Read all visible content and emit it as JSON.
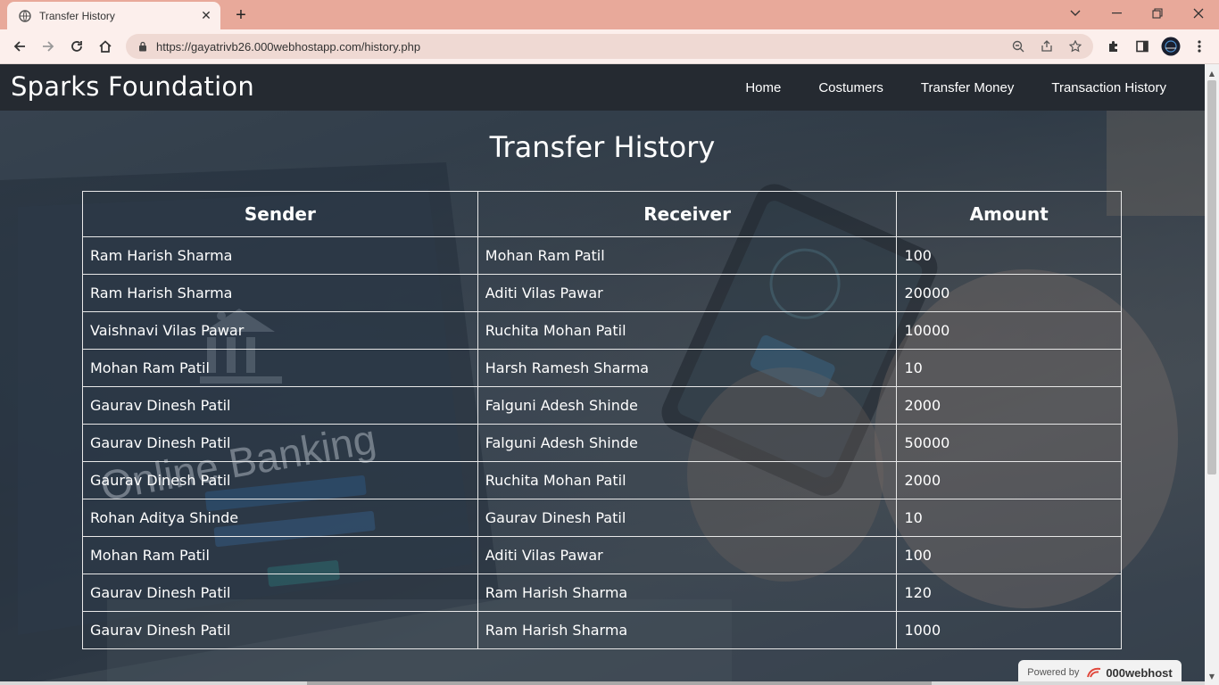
{
  "browser": {
    "tab_title": "Transfer History",
    "tab_close": "✕",
    "new_tab": "+",
    "url": "https://gayatrivb26.000webhostapp.com/history.php",
    "window_controls": {
      "chevron": "⌄",
      "minimize": "—",
      "restore": "❐",
      "close": "✕"
    }
  },
  "navbar": {
    "brand": "Sparks Foundation",
    "links": [
      "Home",
      "Costumers",
      "Transfer Money",
      "Transaction History"
    ]
  },
  "page": {
    "title": "Transfer History"
  },
  "table": {
    "headers": [
      "Sender",
      "Receiver",
      "Amount"
    ],
    "rows": [
      [
        "Ram Harish Sharma",
        "Mohan Ram Patil",
        "100"
      ],
      [
        "Ram Harish Sharma",
        "Aditi Vilas Pawar",
        "20000"
      ],
      [
        "Vaishnavi Vilas Pawar",
        "Ruchita Mohan Patil",
        "10000"
      ],
      [
        "Mohan Ram Patil",
        "Harsh Ramesh Sharma",
        "10"
      ],
      [
        "Gaurav Dinesh Patil",
        "Falguni Adesh Shinde",
        "2000"
      ],
      [
        "Gaurav Dinesh Patil",
        "Falguni Adesh Shinde",
        "50000"
      ],
      [
        "Gaurav Dinesh Patil",
        "Ruchita Mohan Patil",
        "2000"
      ],
      [
        "Rohan Aditya Shinde",
        "Gaurav Dinesh Patil",
        "10"
      ],
      [
        "Mohan Ram Patil",
        "Aditi Vilas Pawar",
        "100"
      ],
      [
        "Gaurav Dinesh Patil",
        "Ram Harish Sharma",
        "120"
      ],
      [
        "Gaurav Dinesh Patil",
        "Ram Harish Sharma",
        "1000"
      ]
    ]
  },
  "background": {
    "watermark_text": "Online Banking"
  },
  "footer_badge": {
    "prefix": "Powered by",
    "brand": "000webhost"
  },
  "colors": {
    "tabbar": "#e8a99a",
    "navbar": "#252a31",
    "text": "#ffffff",
    "accent_logo": "#e0463a"
  }
}
